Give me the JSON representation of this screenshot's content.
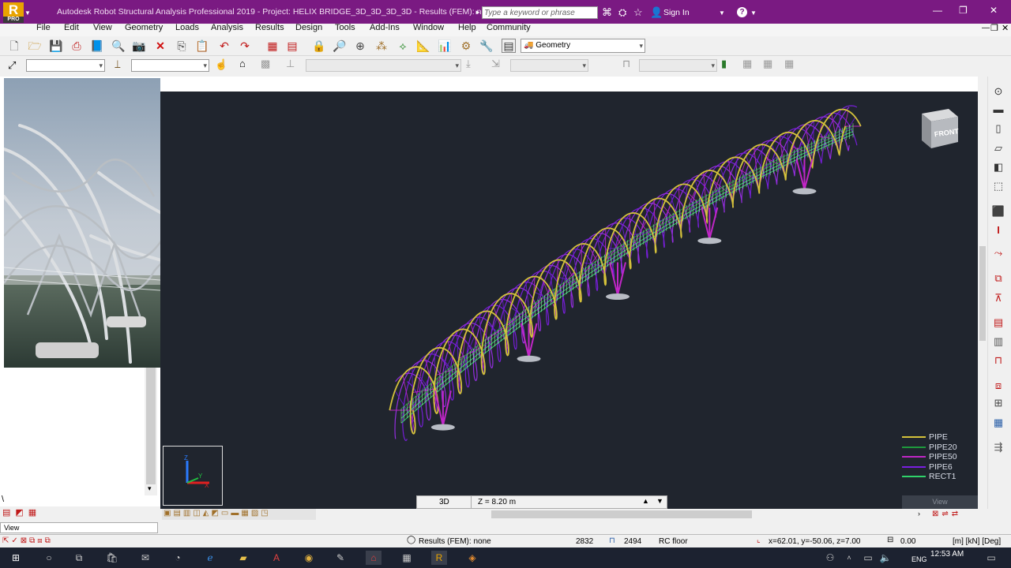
{
  "window": {
    "title": "Autodesk Robot Structural Analysis Professional 2019 - Project: HELIX BRIDGE_3D_3D_3D_3D - Results (FEM): none",
    "app_letter": "R",
    "edition": "PRO",
    "search_placeholder": "Type a keyword or phrase",
    "sign_in": "Sign In",
    "help": "?"
  },
  "menu": [
    "File",
    "Edit",
    "View",
    "Geometry",
    "Loads",
    "Analysis",
    "Results",
    "Design",
    "Tools",
    "Add-Ins",
    "Window",
    "Help",
    "Community"
  ],
  "toolbar": {
    "layout_select": "Geometry"
  },
  "viewport": {
    "legend": [
      {
        "name": "PIPE",
        "color": "#d4c23a"
      },
      {
        "name": "PIPE20",
        "color": "#1e9a3c"
      },
      {
        "name": "PIPE50",
        "color": "#c026c6"
      },
      {
        "name": "PIPE6",
        "color": "#7a1ee0"
      },
      {
        "name": "RECT1",
        "color": "#2fd36a"
      }
    ],
    "view_label": "3D",
    "z_level": "Z = 8.20 m",
    "viewcube_face": "FRONT",
    "axis_z": "Z",
    "axis_x": "X",
    "axis_y": "Y",
    "corner_tab": "View"
  },
  "left_panel": {
    "view_tab": "View"
  },
  "status": {
    "results": "Results (FEM): none",
    "nodes": "2832",
    "bars": "2494",
    "section": "RC floor",
    "coords": "x=62.01, y=-50.06, z=7.00",
    "angle": "0.00",
    "units": "[m] [kN] [Deg]"
  },
  "taskbar": {
    "time": "12:53 AM",
    "lang": "ENG"
  }
}
